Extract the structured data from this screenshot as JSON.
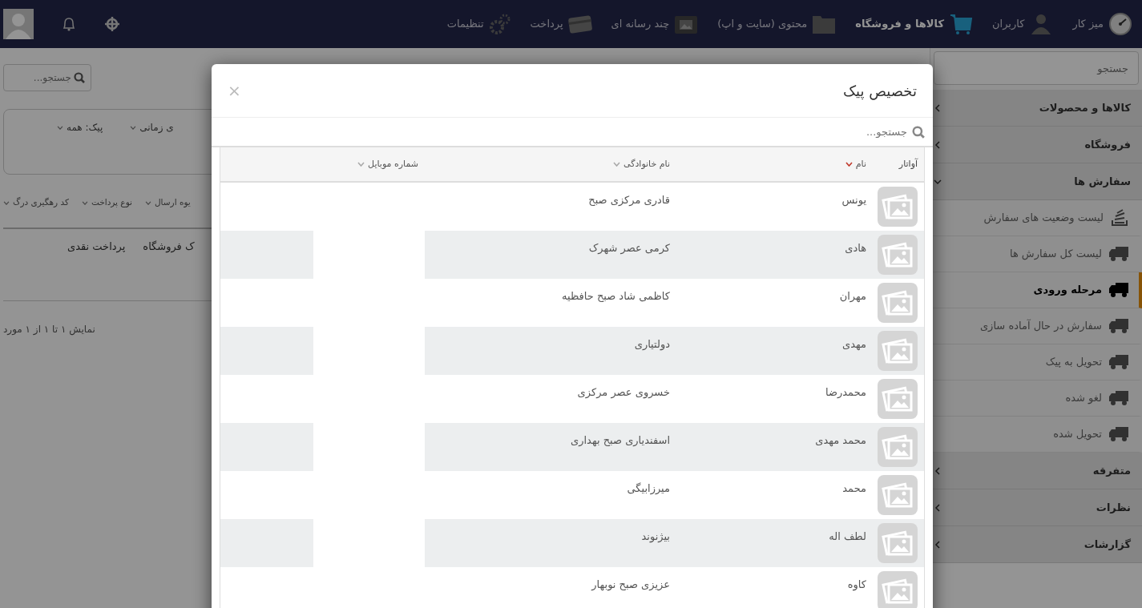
{
  "topnav": {
    "items": [
      {
        "label": "میز کار",
        "selected": false
      },
      {
        "label": "کاربران",
        "selected": false
      },
      {
        "label": "کالاها و فروشگاه",
        "selected": true
      },
      {
        "label": "محتوی (سایت و اپ)",
        "selected": false
      },
      {
        "label": "چند رسانه ای",
        "selected": false
      },
      {
        "label": "پرداخت",
        "selected": false
      },
      {
        "label": "تنظیمات",
        "selected": false
      }
    ]
  },
  "sidebar": {
    "search": {
      "placeholder": "جستجو"
    },
    "sections": [
      {
        "label": "کالاها و محصولات",
        "expanded": false
      },
      {
        "label": "فروشگاه",
        "expanded": false
      },
      {
        "label": "سفارش ها",
        "expanded": true,
        "children": [
          {
            "label": "لیست وضعیت های سفارش",
            "kind": "list",
            "selected": false
          },
          {
            "label": "لیست کل سفارش ها",
            "kind": "truck",
            "selected": false
          },
          {
            "label": "مرحله ورودی",
            "kind": "truck",
            "selected": true
          },
          {
            "label": "سفارش در حال آماده سازی",
            "kind": "truck",
            "selected": false
          },
          {
            "label": "تحویل به پیک",
            "kind": "truck",
            "selected": false
          },
          {
            "label": "لغو شده",
            "kind": "truck",
            "selected": false
          },
          {
            "label": "تحویل شده",
            "kind": "truck",
            "selected": false
          }
        ]
      },
      {
        "label": "متفرقه",
        "expanded": false
      },
      {
        "label": "نظرات",
        "expanded": false
      },
      {
        "label": "گزارشات",
        "expanded": false
      }
    ]
  },
  "content": {
    "search": {
      "placeholder": "جستجو..."
    },
    "filters": [
      {
        "label": "ی زمانی"
      },
      {
        "label": "پیک:",
        "value": "همه"
      }
    ],
    "table": {
      "columns": [
        "یوه ارسال",
        "نوع پرداخت",
        "کد رهگیری درگ"
      ],
      "rows": [
        [
          "ک فروشگاه",
          "پرداخت نقدی"
        ]
      ]
    },
    "footer": "نمایش ۱ تا ۱ از ۱ مورد"
  },
  "modal": {
    "title": "تخصیص پیک",
    "close": "×",
    "search": {
      "placeholder": "جستجو..."
    },
    "columns": [
      {
        "label": "آواتار",
        "sortable": false,
        "sorted": false
      },
      {
        "label": "نام",
        "sortable": true,
        "sorted": true
      },
      {
        "label": "نام خانوادگی",
        "sortable": true,
        "sorted": false
      },
      {
        "label": "شماره موبایل",
        "sortable": true,
        "sorted": false
      }
    ],
    "rows": [
      {
        "name": "یونس",
        "family": "قادری مرکزی صبح"
      },
      {
        "name": "هادی",
        "family": "کرمی عصر شهرک"
      },
      {
        "name": "مهران",
        "family": "کاظمی شاد صبح حافظیه"
      },
      {
        "name": "مهدی",
        "family": "دولتیاری"
      },
      {
        "name": "محمدرضا",
        "family": "خسروی عصر مرکزی"
      },
      {
        "name": "محمد مهدی",
        "family": "اسفندیاری صبح بهداری"
      },
      {
        "name": "محمد",
        "family": "میرزابیگی"
      },
      {
        "name": "لطف اله",
        "family": "بیژنوند"
      },
      {
        "name": "کاوه",
        "family": "عزیزی صبح نوبهار"
      }
    ]
  }
}
